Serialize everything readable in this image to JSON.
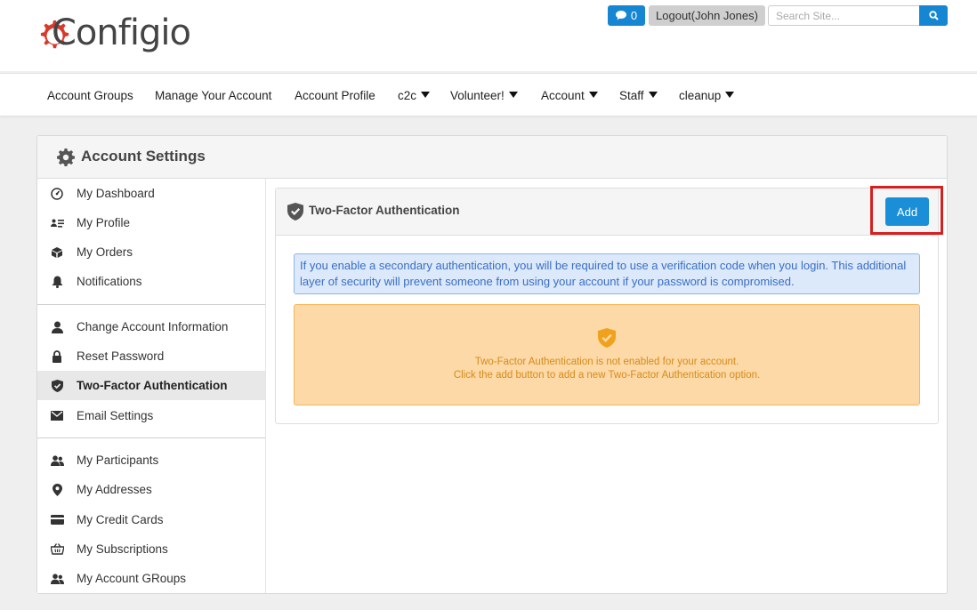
{
  "header": {
    "brand": "Configio",
    "chat_count": "0",
    "logout_label": "Logout(John Jones)",
    "search_placeholder": "Search Site..."
  },
  "nav": {
    "items": [
      {
        "label": "Account Groups",
        "dropdown": false
      },
      {
        "label": "Manage Your Account",
        "dropdown": false
      },
      {
        "label": "Account Profile",
        "dropdown": false
      },
      {
        "label": "c2c",
        "dropdown": true
      },
      {
        "label": "Volunteer!",
        "dropdown": true
      },
      {
        "label": "Account",
        "dropdown": true
      },
      {
        "label": "Staff",
        "dropdown": true
      },
      {
        "label": "cleanup",
        "dropdown": true
      }
    ]
  },
  "panel": {
    "title": "Account Settings"
  },
  "sidebar": {
    "items": [
      {
        "label": "My Dashboard",
        "icon": "dashboard-icon"
      },
      {
        "label": "My Profile",
        "icon": "profile-card-icon"
      },
      {
        "label": "My Orders",
        "icon": "box-icon"
      },
      {
        "label": "Notifications",
        "icon": "bell-icon"
      },
      {
        "label": "Change Account Information",
        "icon": "user-icon"
      },
      {
        "label": "Reset Password",
        "icon": "lock-icon"
      },
      {
        "label": "Two-Factor Authentication",
        "icon": "shield-check-icon",
        "active": true
      },
      {
        "label": "Email Settings",
        "icon": "envelope-icon"
      },
      {
        "label": "My Participants",
        "icon": "users-icon"
      },
      {
        "label": "My Addresses",
        "icon": "map-pin-icon"
      },
      {
        "label": "My Credit Cards",
        "icon": "credit-card-icon"
      },
      {
        "label": "My Subscriptions",
        "icon": "subscription-basket-icon"
      },
      {
        "label": "My Account GRoups",
        "icon": "group-icon"
      }
    ]
  },
  "content": {
    "title": "Two-Factor Authentication",
    "add_label": "Add",
    "info_text": "If you enable a secondary authentication, you will be required to use a verification code when you login. This additional layer of security will prevent someone from using your account if your password is compromised.",
    "warning_line1": "Two-Factor Authentication is not enabled for your account.",
    "warning_line2": "Click the add button to add a new Two-Factor Authentication option."
  },
  "colors": {
    "brand_red": "#d7392b",
    "primary_blue": "#1686d2",
    "highlight_red": "#d71f1f",
    "info_bg": "#dbe9fb",
    "warning_bg": "#fcd9a6",
    "warning_text": "#d78b1a"
  }
}
